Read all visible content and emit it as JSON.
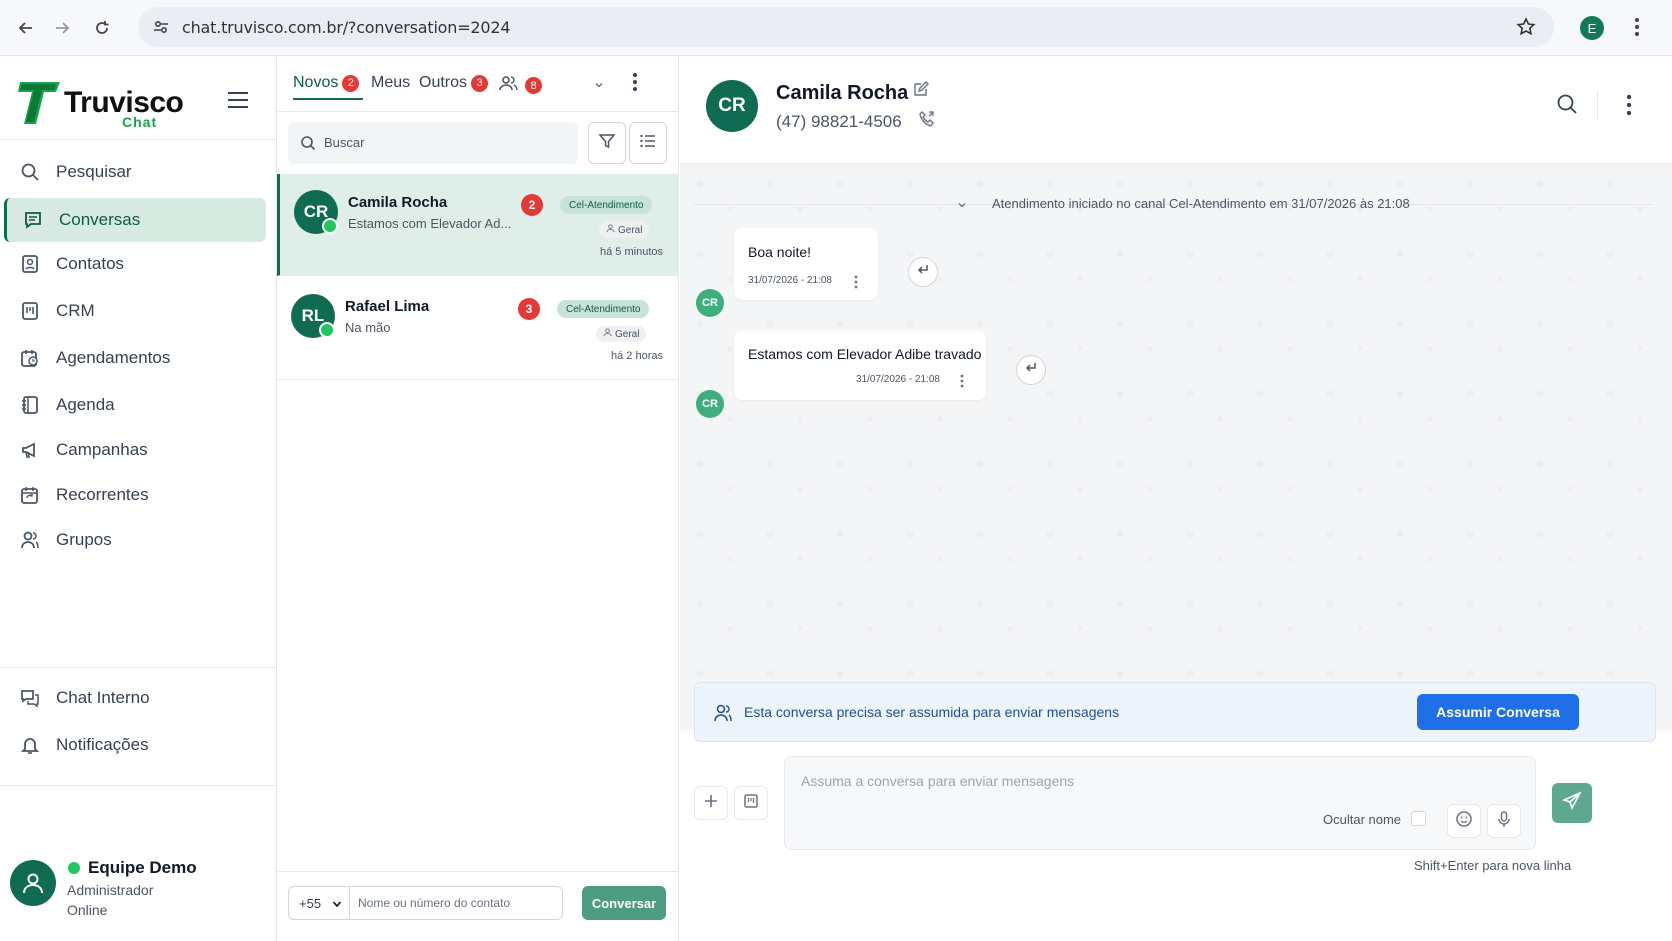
{
  "browser": {
    "url": "chat.truvisco.com.br/?conversation=2024",
    "profile_initial": "E"
  },
  "brand": {
    "name": "Truvisco",
    "sub": "Chat"
  },
  "sidebar": {
    "items": [
      {
        "label": "Pesquisar",
        "icon": "search-icon"
      },
      {
        "label": "Conversas",
        "icon": "chat-icon",
        "active": true
      },
      {
        "label": "Contatos",
        "icon": "contacts-icon"
      },
      {
        "label": "CRM",
        "icon": "kanban-icon"
      },
      {
        "label": "Agendamentos",
        "icon": "calendar-clock-icon"
      },
      {
        "label": "Agenda",
        "icon": "notebook-icon"
      },
      {
        "label": "Campanhas",
        "icon": "megaphone-icon"
      },
      {
        "label": "Recorrentes",
        "icon": "calendar-repeat-icon"
      },
      {
        "label": "Grupos",
        "icon": "users-icon"
      }
    ],
    "bottom_items": [
      {
        "label": "Chat Interno",
        "icon": "chat-bubbles-icon"
      },
      {
        "label": "Notificações",
        "icon": "bell-icon"
      }
    ],
    "user": {
      "name": "Equipe Demo",
      "role": "Administrador",
      "status": "Online"
    }
  },
  "conv_list": {
    "tabs": [
      {
        "label": "Novos",
        "count": "2",
        "active": true
      },
      {
        "label": "Meus",
        "count": ""
      },
      {
        "label": "Outros",
        "count": "3"
      },
      {
        "label": "",
        "count": "8",
        "icon": "group-icon"
      }
    ],
    "search_placeholder": "Buscar",
    "conversations": [
      {
        "initials": "CR",
        "name": "Camila Rocha",
        "preview": "Estamos com Elevador Ad...",
        "unread": "2",
        "channel": "Cel-Atendimento",
        "queue": "Geral",
        "time": "há 5 minutos",
        "selected": true
      },
      {
        "initials": "RL",
        "name": "Rafael Lima",
        "preview": "Na mão",
        "unread": "3",
        "channel": "Cel-Atendimento",
        "queue": "Geral",
        "time": "há 2 horas",
        "selected": false
      }
    ],
    "new_conversation": {
      "country_code": "+55",
      "placeholder": "Nome ou número do contato",
      "button": "Conversar"
    }
  },
  "chat": {
    "contact": {
      "initials": "CR",
      "name": "Camila Rocha",
      "phone": "(47) 98821-4506"
    },
    "system_message": "Atendimento iniciado no canal Cel-Atendimento em 31/07/2026 às 21:08",
    "messages": [
      {
        "text": "Boa noite!",
        "time": "31/07/2026 - 21:08",
        "avatar": "CR"
      },
      {
        "text": "Estamos com Elevador Adibe travado",
        "time": "31/07/2026 - 21:08",
        "avatar": "CR"
      }
    ],
    "notice": "Esta conversa precisa ser assumida para enviar mensagens",
    "assume_button": "Assumir Conversa",
    "composer_placeholder": "Assuma a conversa para enviar mensagens",
    "hide_name_label": "Ocultar nome",
    "hint": "Shift+Enter para nova linha"
  },
  "colors": {
    "brand_green": "#0f6b52",
    "accent_blue": "#1e6fe8",
    "badge_red": "#e53935",
    "whatsapp_green": "#22c55e"
  }
}
